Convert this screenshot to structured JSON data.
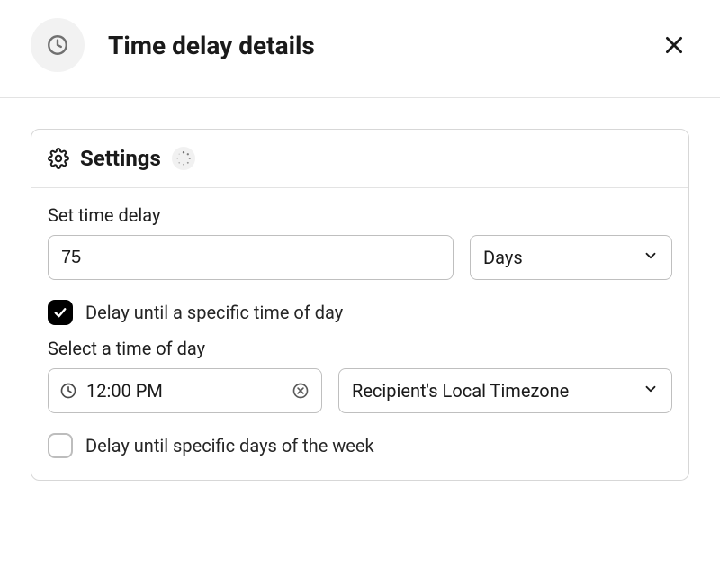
{
  "header": {
    "title": "Time delay details"
  },
  "settings": {
    "title": "Settings",
    "timeDelay": {
      "label": "Set time delay",
      "value": "75",
      "unit": "Days"
    },
    "delayUntilTimeOfDay": {
      "checked": true,
      "label": "Delay until a specific time of day"
    },
    "timeOfDay": {
      "label": "Select a time of day",
      "value": "12:00 PM",
      "timezone": "Recipient's Local Timezone"
    },
    "delayUntilDaysOfWeek": {
      "checked": false,
      "label": "Delay until specific days of the week"
    }
  }
}
